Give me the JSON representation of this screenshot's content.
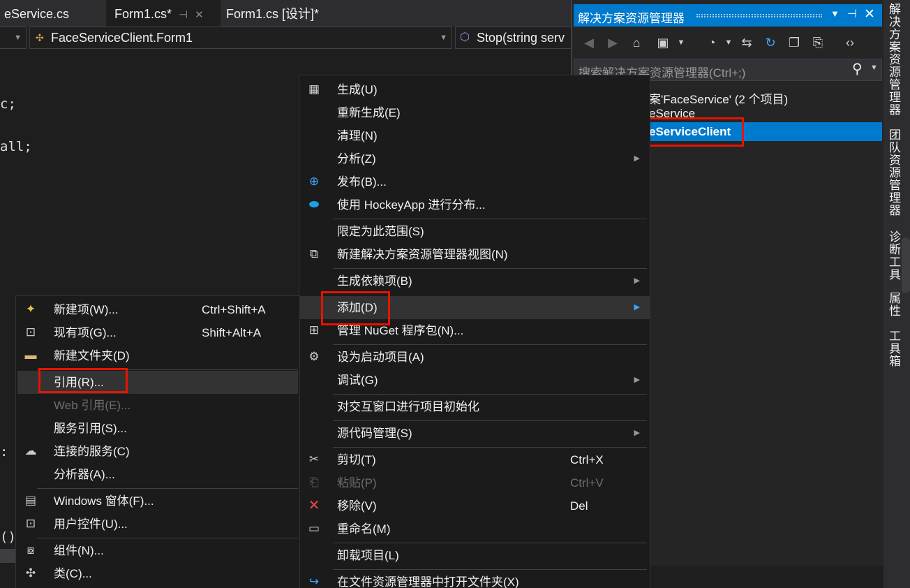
{
  "tabs": [
    {
      "label": "eService.cs"
    },
    {
      "label": "Form1.cs*",
      "pin": "⊣",
      "close": "✕"
    },
    {
      "label": "Form1.cs [设计]*"
    }
  ],
  "nav": {
    "class_combo": "FaceServiceClient.Form1",
    "member_combo": "Stop(string serv"
  },
  "code": {
    "line1": "c;",
    "line2": "all;",
    "line3": ":",
    "line4": "()"
  },
  "solution_explorer": {
    "title": "解决方案资源管理器",
    "search_placeholder": "搜索解决方案资源管理器(Ctrl+;)",
    "tree": [
      {
        "label": "案'FaceService' (2 个项目)"
      },
      {
        "label": "eService"
      },
      {
        "label": "eServiceClient",
        "selected": true
      }
    ]
  },
  "side_tabs": [
    "解决方案资源管理器",
    "团队资源管理器",
    "诊断工具",
    "属性",
    "工具箱"
  ],
  "context_menu": {
    "items": [
      {
        "label": "生成(U)",
        "icon": "build-icon"
      },
      {
        "label": "重新生成(E)"
      },
      {
        "label": "清理(N)"
      },
      {
        "label": "分析(Z)",
        "submenu": "▶"
      },
      {
        "label": "发布(B)...",
        "icon": "globe-icon"
      },
      {
        "label": "使用 HockeyApp 进行分布...",
        "icon": "hockeyapp-icon"
      },
      {
        "label": "限定为此范围(S)"
      },
      {
        "label": "新建解决方案资源管理器视图(N)",
        "icon": "new-view-icon"
      },
      {
        "label": "生成依赖项(B)",
        "submenu": "▶"
      },
      {
        "label": "添加(D)",
        "submenu": "▶"
      },
      {
        "label": "管理 NuGet 程序包(N)...",
        "icon": "nuget-icon"
      },
      {
        "label": "设为启动项目(A)",
        "icon": "gear-icon"
      },
      {
        "label": "调试(G)",
        "submenu": "▶"
      },
      {
        "label": "对交互窗口进行项目初始化"
      },
      {
        "label": "源代码管理(S)",
        "submenu": "▶"
      },
      {
        "label": "剪切(T)",
        "shortcut": "Ctrl+X",
        "icon": "scissors-icon"
      },
      {
        "label": "粘贴(P)",
        "shortcut": "Ctrl+V",
        "icon": "paste-icon",
        "disabled": true
      },
      {
        "label": "移除(V)",
        "shortcut": "Del",
        "icon": "remove-icon"
      },
      {
        "label": "重命名(M)",
        "icon": "rename-icon"
      },
      {
        "label": "卸载项目(L)"
      },
      {
        "label": "在文件资源管理器中打开文件夹(X)",
        "icon": "open-folder-icon"
      }
    ]
  },
  "add_submenu": {
    "items": [
      {
        "label": "新建项(W)...",
        "shortcut": "Ctrl+Shift+A",
        "icon": "new-item-icon"
      },
      {
        "label": "现有项(G)...",
        "shortcut": "Shift+Alt+A",
        "icon": "existing-item-icon"
      },
      {
        "label": "新建文件夹(D)",
        "icon": "new-folder-icon"
      },
      {
        "label": "引用(R)..."
      },
      {
        "label": "Web 引用(E)...",
        "disabled": true
      },
      {
        "label": "服务引用(S)..."
      },
      {
        "label": "连接的服务(C)",
        "icon": "connected-service-icon"
      },
      {
        "label": "分析器(A)..."
      },
      {
        "label": "Windows 窗体(F)...",
        "icon": "windows-form-icon"
      },
      {
        "label": "用户控件(U)...",
        "icon": "user-control-icon"
      },
      {
        "label": "组件(N)...",
        "icon": "component-icon"
      },
      {
        "label": "类(C)...",
        "icon": "class-icon"
      }
    ]
  },
  "colors": {
    "accent": "#007acc",
    "highlight_box": "#e51400",
    "menu_bg": "#1b1b1c",
    "editor_bg": "#1e1e1e"
  }
}
